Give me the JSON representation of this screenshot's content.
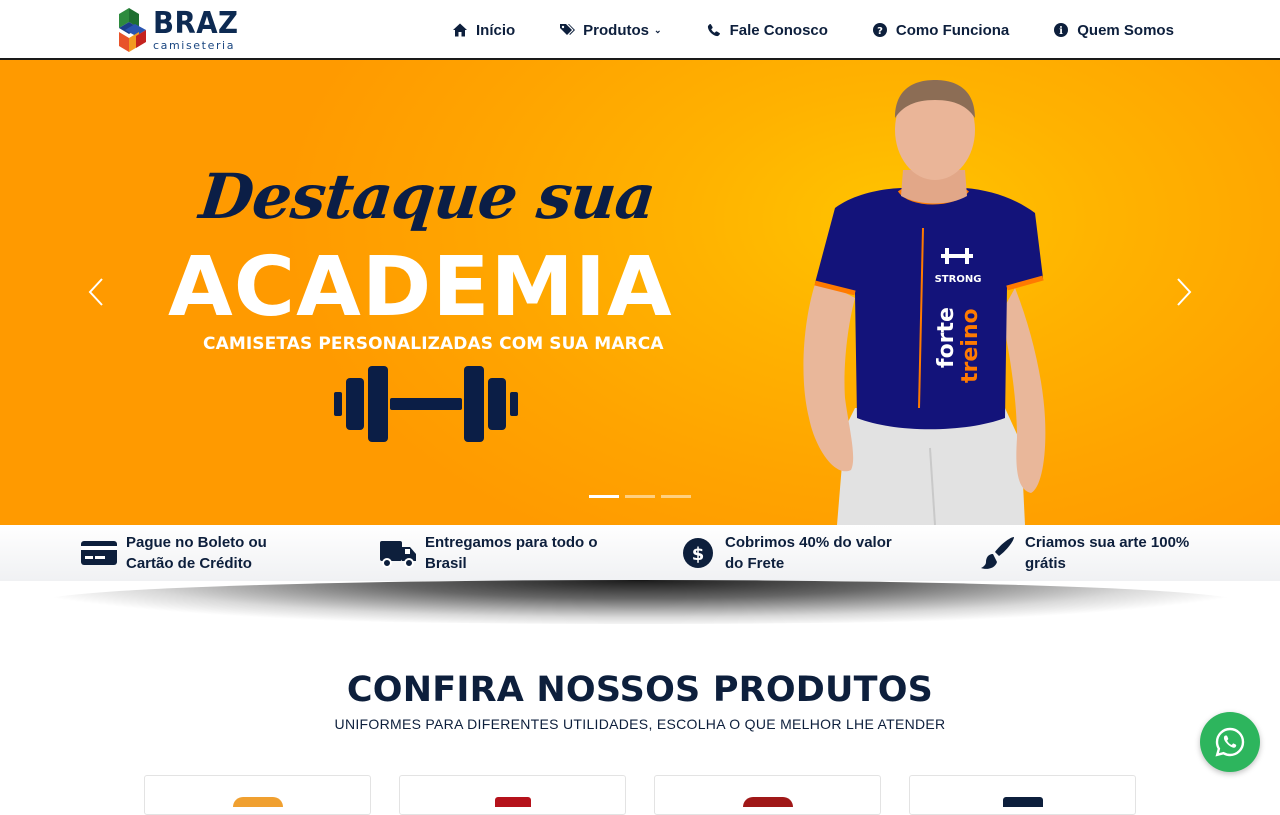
{
  "brand": {
    "name": "BRAZ",
    "tagline": "camiseteria"
  },
  "nav": {
    "items": [
      {
        "label": "Início",
        "icon": "home-icon"
      },
      {
        "label": "Produtos",
        "icon": "tags-icon",
        "has_dropdown": true
      },
      {
        "label": "Fale Conosco",
        "icon": "phone-icon"
      },
      {
        "label": "Como Funciona",
        "icon": "question-circle-icon"
      },
      {
        "label": "Quem Somos",
        "icon": "info-circle-icon"
      }
    ]
  },
  "hero": {
    "script_title": "Destaque sua",
    "big_title": "ACADEMIA",
    "subtitle": "CAMISETAS PERSONALIZADAS COM SUA MARCA",
    "shirt_text_strong": "STRONG",
    "shirt_text_forte": "forte",
    "shirt_text_treino": "treino",
    "slides_total": 3,
    "active_slide": 1
  },
  "features": [
    {
      "line1": "Pague no Boleto ou",
      "line2": "Cartão de Crédito",
      "icon": "credit-card-icon"
    },
    {
      "line1": "Entregamos para todo o",
      "line2": "Brasil",
      "icon": "truck-icon"
    },
    {
      "line1": "Cobrimos 40% do valor",
      "line2": "do Frete",
      "icon": "dollar-circle-icon"
    },
    {
      "line1": "Criamos sua arte 100%",
      "line2": "grátis",
      "icon": "paintbrush-icon"
    }
  ],
  "products": {
    "title": "CONFIRA NOSSOS PRODUTOS",
    "subtitle": "UNIFORMES PARA DIFERENTES UTILIDADES, ESCOLHA O QUE MELHOR LHE ATENDER"
  },
  "colors": {
    "navy": "#0d1f3c",
    "hero_orange": "#ffa400",
    "whatsapp_green": "#2db55d"
  }
}
